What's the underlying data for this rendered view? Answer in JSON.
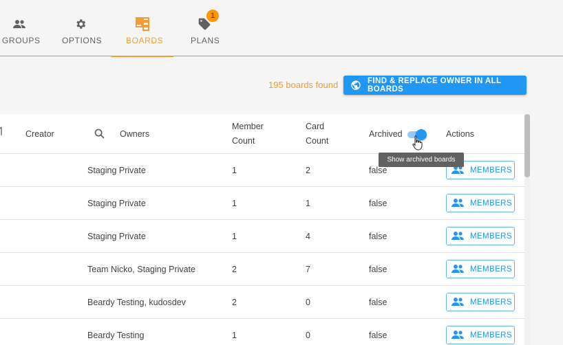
{
  "tabs": [
    {
      "label": "GROUPS",
      "icon": "people-icon"
    },
    {
      "label": "OPTIONS",
      "icon": "gear-icon"
    },
    {
      "label": "BOARDS",
      "icon": "boards-icon",
      "active": true
    },
    {
      "label": "PLANS",
      "icon": "tag-icon",
      "badge": "1"
    }
  ],
  "results": {
    "found_text": "195 boards found",
    "find_replace_label": "FIND & REPLACE OWNER IN ALL BOARDS"
  },
  "table": {
    "headers": {
      "creator": "Creator",
      "owners": "Owners",
      "member_count_1": "Member",
      "member_count_2": "Count",
      "card_count_1": "Card",
      "card_count_2": "Count",
      "archived": "Archived",
      "actions": "Actions"
    },
    "archived_toggle_on": true,
    "tooltip": "Show archived boards",
    "rows": [
      {
        "owners": "Staging Private",
        "member_count": "1",
        "card_count": "2",
        "archived": "false",
        "action": "MEMBERS"
      },
      {
        "owners": "Staging Private",
        "member_count": "1",
        "card_count": "1",
        "archived": "false",
        "action": "MEMBERS"
      },
      {
        "owners": "Staging Private",
        "member_count": "1",
        "card_count": "4",
        "archived": "false",
        "action": "MEMBERS"
      },
      {
        "owners": "Team Nicko, Staging Private",
        "member_count": "2",
        "card_count": "7",
        "archived": "false",
        "action": "MEMBERS"
      },
      {
        "owners": "Beardy Testing, kudosdev",
        "member_count": "2",
        "card_count": "0",
        "archived": "false",
        "action": "MEMBERS"
      },
      {
        "owners": "Beardy Testing",
        "member_count": "1",
        "card_count": "0",
        "archived": "false",
        "action": "MEMBERS"
      }
    ]
  },
  "colors": {
    "accent": "#f39c34",
    "primary": "#2196f3",
    "badge": "#ff9800"
  }
}
